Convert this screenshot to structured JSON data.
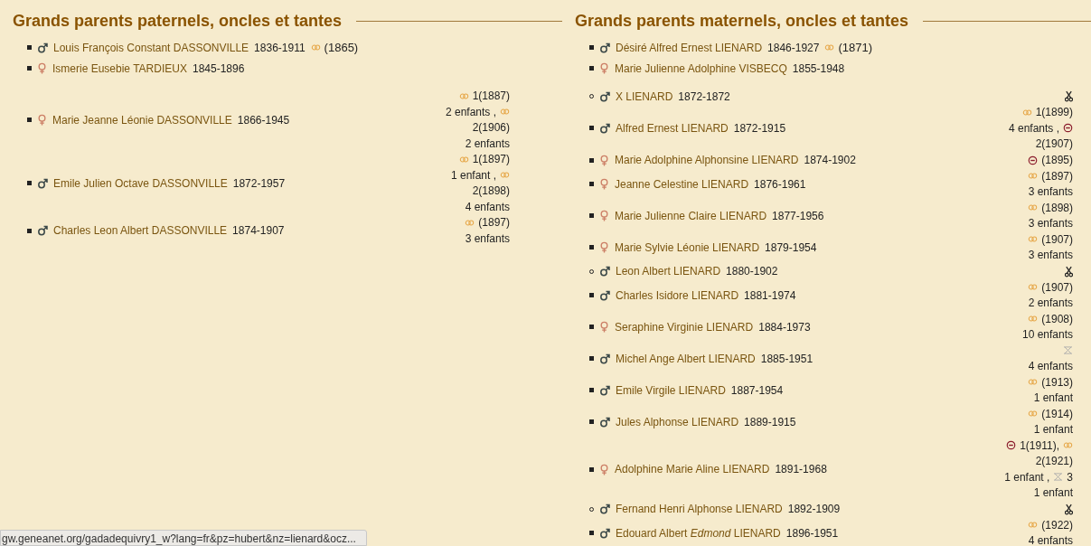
{
  "columns": [
    {
      "title": "Grands parents paternels, oncles et tantes",
      "parents": [
        {
          "kind": "male",
          "name": "Louis François Constant DASSONVILLE",
          "dates": "1836-1911",
          "union": [
            {
              "kind": "marriage"
            },
            {
              "kind": "text",
              "text": "(1865)"
            }
          ]
        },
        {
          "kind": "female",
          "name": "Ismerie Eusebie TARDIEUX",
          "dates": "1845-1896"
        }
      ],
      "children": [
        {
          "hollow_bullet": false,
          "kind": "female",
          "name": "Marie Jeanne Léonie DASSONVILLE",
          "dates": "1866-1945",
          "lines": [
            [
              {
                "kind": "marriage"
              },
              {
                "kind": "text",
                "text": "1(1887)"
              }
            ],
            [
              {
                "kind": "text",
                "text": "2 enfants ,"
              },
              {
                "kind": "marriage"
              }
            ],
            [
              {
                "kind": "text",
                "text": "2(1906)"
              }
            ],
            [
              {
                "kind": "text",
                "text": "2 enfants"
              }
            ]
          ]
        },
        {
          "hollow_bullet": false,
          "kind": "male",
          "name": "Emile Julien Octave DASSONVILLE",
          "dates": "1872-1957",
          "lines": [
            [
              {
                "kind": "marriage"
              },
              {
                "kind": "text",
                "text": "1(1897)"
              }
            ],
            [
              {
                "kind": "text",
                "text": "1 enfant ,"
              },
              {
                "kind": "marriage"
              }
            ],
            [
              {
                "kind": "text",
                "text": "2(1898)"
              }
            ],
            [
              {
                "kind": "text",
                "text": "4 enfants"
              }
            ]
          ]
        },
        {
          "hollow_bullet": false,
          "kind": "male",
          "name": "Charles Leon Albert DASSONVILLE",
          "dates": "1874-1907",
          "lines": [
            [
              {
                "kind": "marriage"
              },
              {
                "kind": "text",
                "text": "(1897)"
              }
            ],
            [
              {
                "kind": "text",
                "text": "3 enfants"
              }
            ]
          ]
        }
      ]
    },
    {
      "title": "Grands parents maternels, oncles et tantes",
      "parents": [
        {
          "kind": "male",
          "name": "Désiré Alfred Ernest LIENARD",
          "dates": "1846-1927",
          "union": [
            {
              "kind": "marriage"
            },
            {
              "kind": "text",
              "text": "(1871)"
            }
          ]
        },
        {
          "kind": "female",
          "name": "Marie Julienne Adolphine VISBECQ",
          "dates": "1855-1948"
        }
      ],
      "children": [
        {
          "hollow_bullet": true,
          "kind": "male",
          "name": "X LIENARD",
          "dates": "1872-1872",
          "lines": [
            [
              {
                "kind": "scissors"
              }
            ]
          ]
        },
        {
          "hollow_bullet": false,
          "kind": "male",
          "name": "Alfred Ernest LIENARD",
          "dates": "1872-1915",
          "lines": [
            [
              {
                "kind": "marriage"
              },
              {
                "kind": "text",
                "text": "1(1899)"
              }
            ],
            [
              {
                "kind": "text",
                "text": "4 enfants ,"
              },
              {
                "kind": "divorce"
              }
            ],
            [
              {
                "kind": "text",
                "text": "2(1907)"
              }
            ]
          ]
        },
        {
          "hollow_bullet": false,
          "kind": "female",
          "name": "Marie Adolphine Alphonsine LIENARD",
          "dates": "1874-1902",
          "lines": [
            [
              {
                "kind": "divorce"
              },
              {
                "kind": "text",
                "text": "(1895)"
              }
            ]
          ]
        },
        {
          "hollow_bullet": false,
          "kind": "female",
          "name": "Jeanne Celestine LIENARD",
          "dates": "1876-1961",
          "lines": [
            [
              {
                "kind": "marriage"
              },
              {
                "kind": "text",
                "text": "(1897)"
              }
            ],
            [
              {
                "kind": "text",
                "text": "3 enfants"
              }
            ]
          ]
        },
        {
          "hollow_bullet": false,
          "kind": "female",
          "name": "Marie Julienne Claire LIENARD",
          "dates": "1877-1956",
          "lines": [
            [
              {
                "kind": "marriage"
              },
              {
                "kind": "text",
                "text": "(1898)"
              }
            ],
            [
              {
                "kind": "text",
                "text": "3 enfants"
              }
            ]
          ]
        },
        {
          "hollow_bullet": false,
          "kind": "female",
          "name": "Marie Sylvie Léonie LIENARD",
          "dates": "1879-1954",
          "lines": [
            [
              {
                "kind": "marriage"
              },
              {
                "kind": "text",
                "text": "(1907)"
              }
            ],
            [
              {
                "kind": "text",
                "text": "3 enfants"
              }
            ]
          ]
        },
        {
          "hollow_bullet": true,
          "kind": "male",
          "name": "Leon Albert LIENARD",
          "dates": "1880-1902",
          "lines": [
            [
              {
                "kind": "scissors"
              }
            ]
          ]
        },
        {
          "hollow_bullet": false,
          "kind": "male",
          "name": "Charles Isidore LIENARD",
          "dates": "1881-1974",
          "lines": [
            [
              {
                "kind": "marriage"
              },
              {
                "kind": "text",
                "text": "(1907)"
              }
            ],
            [
              {
                "kind": "text",
                "text": "2 enfants"
              }
            ]
          ]
        },
        {
          "hollow_bullet": false,
          "kind": "female",
          "name": "Seraphine Virginie LIENARD",
          "dates": "1884-1973",
          "lines": [
            [
              {
                "kind": "marriage"
              },
              {
                "kind": "text",
                "text": "(1908)"
              }
            ],
            [
              {
                "kind": "text",
                "text": "10 enfants"
              }
            ]
          ]
        },
        {
          "hollow_bullet": false,
          "kind": "male",
          "name": "Michel Ange Albert LIENARD",
          "dates": "1885-1951",
          "lines": [
            [
              {
                "kind": "union"
              }
            ],
            [
              {
                "kind": "text",
                "text": "4 enfants"
              }
            ]
          ]
        },
        {
          "hollow_bullet": false,
          "kind": "male",
          "name": "Emile Virgile LIENARD",
          "dates": "1887-1954",
          "lines": [
            [
              {
                "kind": "marriage"
              },
              {
                "kind": "text",
                "text": "(1913)"
              }
            ],
            [
              {
                "kind": "text",
                "text": "1 enfant"
              }
            ]
          ]
        },
        {
          "hollow_bullet": false,
          "kind": "male",
          "name": "Jules Alphonse LIENARD",
          "dates": "1889-1915",
          "lines": [
            [
              {
                "kind": "marriage"
              },
              {
                "kind": "text",
                "text": "(1914)"
              }
            ],
            [
              {
                "kind": "text",
                "text": "1 enfant"
              }
            ]
          ]
        },
        {
          "hollow_bullet": false,
          "kind": "female",
          "name": "Adolphine Marie Aline LIENARD",
          "dates": "1891-1968",
          "lines": [
            [
              {
                "kind": "divorce"
              },
              {
                "kind": "text",
                "text": "1(1911),"
              },
              {
                "kind": "marriage"
              }
            ],
            [
              {
                "kind": "text",
                "text": "2(1921)"
              }
            ],
            [
              {
                "kind": "text",
                "text": "1 enfant ,"
              },
              {
                "kind": "union"
              },
              {
                "kind": "text",
                "text": "3"
              }
            ],
            [
              {
                "kind": "text",
                "text": "1 enfant"
              }
            ]
          ]
        },
        {
          "hollow_bullet": true,
          "kind": "male",
          "name": "Fernand Henri Alphonse LIENARD",
          "dates": "1892-1909",
          "lines": [
            [
              {
                "kind": "scissors"
              }
            ]
          ]
        },
        {
          "hollow_bullet": false,
          "kind": "male",
          "name": "Edouard Albert *Edmond* LIENARD",
          "dates": "1896-1951",
          "lines": [
            [
              {
                "kind": "marriage"
              },
              {
                "kind": "text",
                "text": "(1922)"
              }
            ],
            [
              {
                "kind": "text",
                "text": "4 enfants"
              }
            ]
          ]
        }
      ]
    }
  ],
  "status_bar": {
    "url": "gw.geneanet.org/gadadequivry1_w?lang=fr&pz=hubert&nz=lienard&ocz..."
  }
}
